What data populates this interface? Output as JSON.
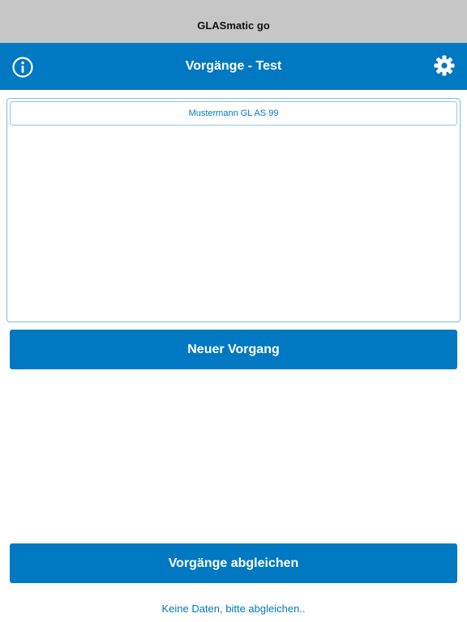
{
  "status_bar": {
    "app_title": "GLASmatic go"
  },
  "nav_bar": {
    "title": "Vorgänge - Test",
    "info_icon": "info-circle-icon",
    "settings_icon": "gear-icon"
  },
  "list": {
    "items": [
      {
        "label": "Mustermann GL AS 99"
      }
    ]
  },
  "buttons": {
    "new_case_label": "Neuer Vorgang",
    "sync_label": "Vorgänge abgleichen"
  },
  "footer": {
    "status_text": "Keine Daten, bitte abgleichen.."
  },
  "colors": {
    "accent": "#0078c2",
    "status_bar_bg": "#c6c6c6",
    "list_border": "#7cc0e4"
  }
}
